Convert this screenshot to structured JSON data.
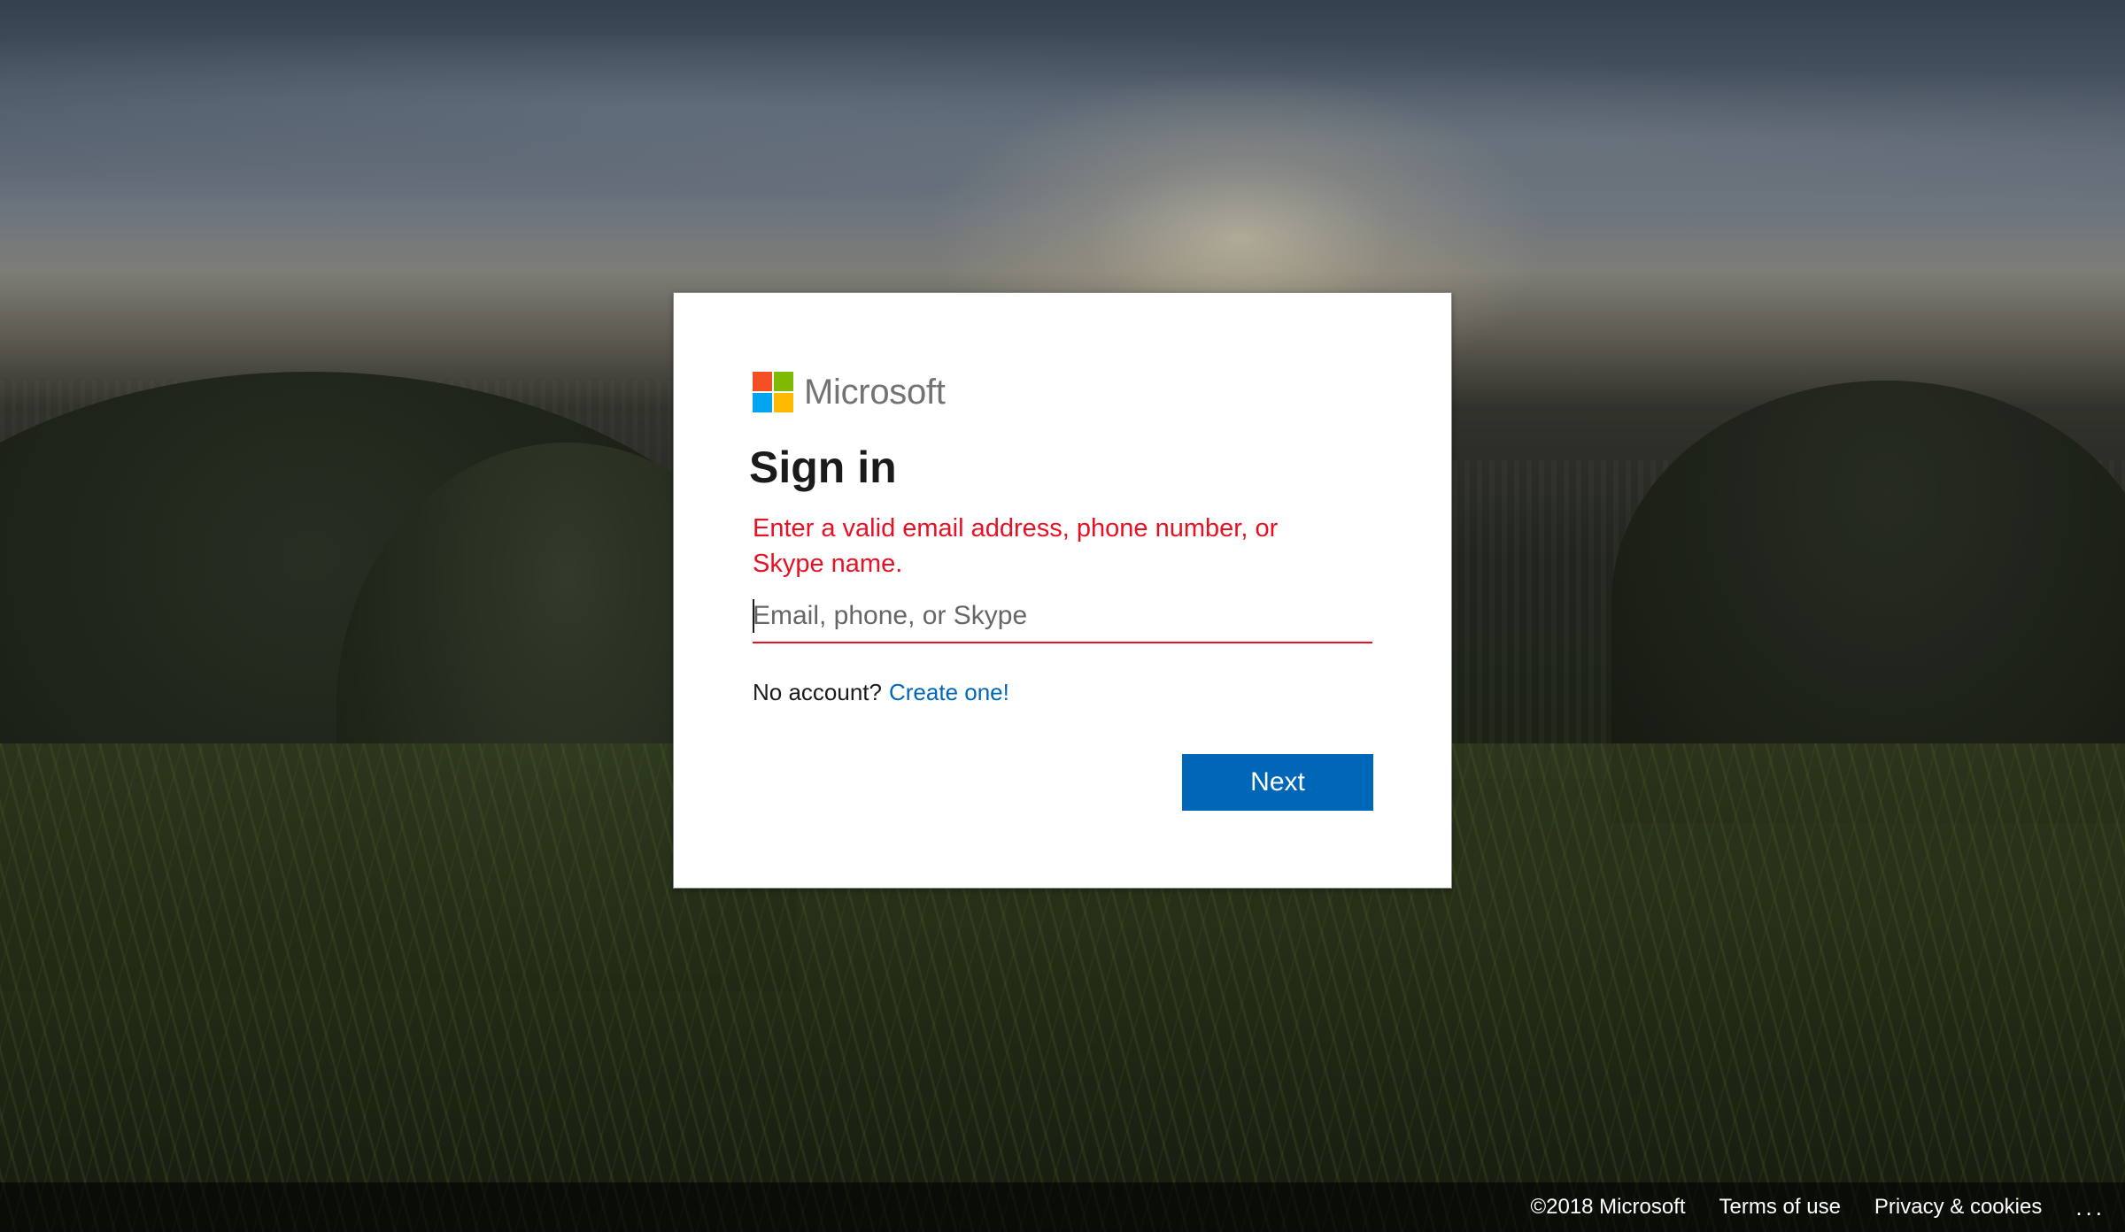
{
  "brand": {
    "name": "Microsoft",
    "colors": {
      "red": "#f25022",
      "green": "#7fba00",
      "blue": "#00a4ef",
      "yellow": "#ffb900"
    }
  },
  "signin": {
    "title": "Sign in",
    "error_message": "Enter a valid email address, phone number, or Skype name.",
    "email": {
      "value": "",
      "placeholder": "Email, phone, or Skype"
    },
    "no_account_text": "No account?",
    "create_link": "Create one!",
    "next_label": "Next"
  },
  "footer": {
    "copyright": "©2018 Microsoft",
    "terms": "Terms of use",
    "privacy": "Privacy & cookies",
    "more": "..."
  },
  "colors": {
    "accent": "#0067b8",
    "error": "#e81123"
  }
}
